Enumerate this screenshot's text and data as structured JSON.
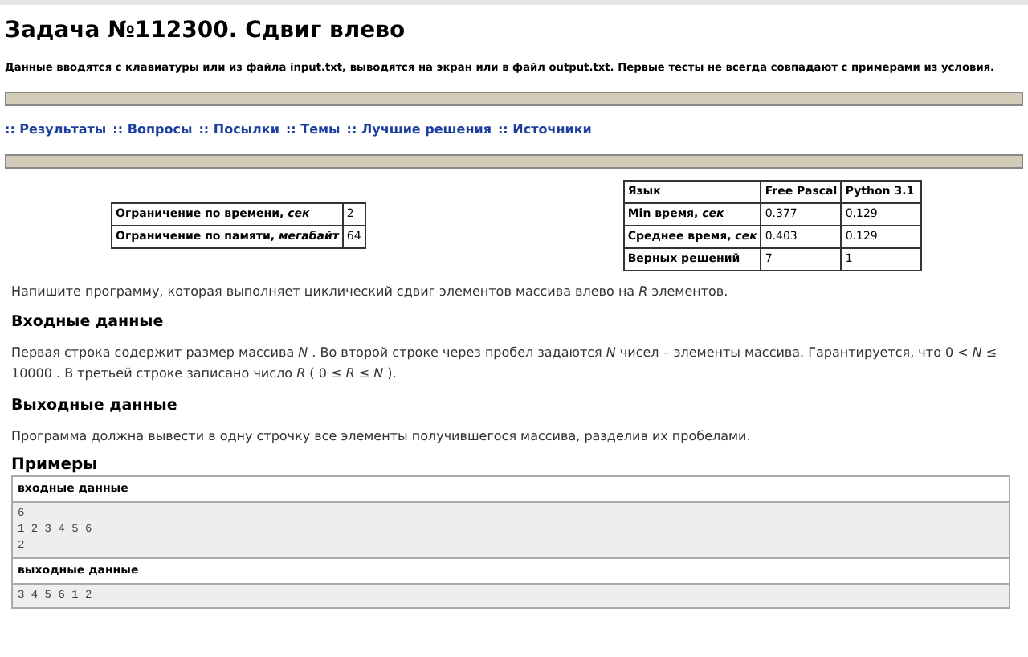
{
  "title": "Задача №112300. Сдвиг влево",
  "notice": "Данные вводятся с клавиатуры или из файла input.txt, выводятся на экран или в файл output.txt. Первые тесты не всегда совпадают с примерами из условия.",
  "nav_links": [
    ":: Результаты",
    ":: Вопросы",
    ":: Посылки",
    ":: Темы",
    ":: Лучшие решения",
    ":: Источники"
  ],
  "limits": [
    {
      "label": "Ограничение по времени, *сек*",
      "value": "2"
    },
    {
      "label": "Ограничение по памяти, *мегабайт*",
      "value": "64"
    }
  ],
  "stats": {
    "columns": [
      "Язык",
      "Free Pascal",
      "Python 3.1"
    ],
    "rows": [
      [
        "Min время, *сек*",
        "0.377",
        "0.129"
      ],
      [
        "Среднее время, *сек*",
        "0.403",
        "0.129"
      ],
      [
        "Верных решений",
        "7",
        "1"
      ]
    ]
  },
  "statement": "Напишите программу, которая выполняет циклический сдвиг элементов массива влево на *R* элементов.",
  "sections": [
    {
      "heading": "Входные данные",
      "text": "Первая строка содержит размер массива *N* . Во второй строке через пробел задаются *N* чисел – элементы массива. Гарантируется, что 0 < *N* ≤ 10000 . В третьей строке записано число *R* ( 0 ≤ *R* ≤ *N* )."
    },
    {
      "heading": "Выходные данные",
      "text": "Программа должна вывести в одну строчку все элементы получившегося массива, разделив их пробелами."
    }
  ],
  "examples": {
    "heading": "Примеры",
    "blocks": [
      {
        "label": "входные данные",
        "lines": [
          "6",
          "1 2 3 4 5 6",
          "2"
        ]
      },
      {
        "label": "выходные данные",
        "lines": [
          "3 4 5 6 1 2"
        ]
      }
    ]
  }
}
